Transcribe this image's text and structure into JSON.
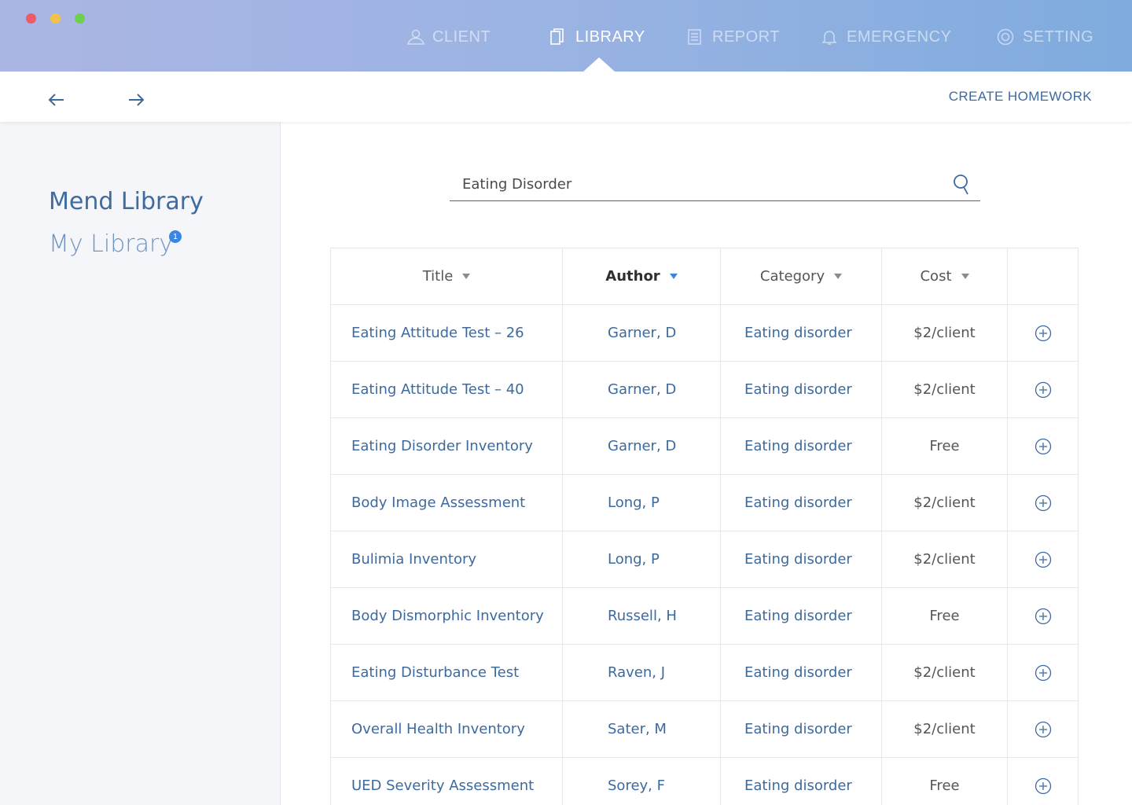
{
  "nav": {
    "items": [
      {
        "label": "CLIENT",
        "icon": "user-icon"
      },
      {
        "label": "LIBRARY",
        "icon": "library-icon"
      },
      {
        "label": "REPORT",
        "icon": "report-icon"
      },
      {
        "label": "EMERGENCY",
        "icon": "bell-icon"
      },
      {
        "label": "SETTING",
        "icon": "settings-icon"
      }
    ],
    "active": "LIBRARY"
  },
  "toolbar": {
    "create_label": "CREATE HOMEWORK"
  },
  "sidebar": {
    "mend_library": "Mend Library",
    "my_library": "My Library",
    "my_library_badge": "1"
  },
  "search": {
    "value": "Eating Disorder",
    "placeholder": ""
  },
  "table": {
    "headers": {
      "title": "Title",
      "author": "Author",
      "category": "Category",
      "cost": "Cost"
    },
    "sorted_by": "Author",
    "rows": [
      {
        "title": "Eating Attitude Test – 26",
        "author": "Garner, D",
        "category": "Eating disorder",
        "cost": "$2/client"
      },
      {
        "title": "Eating Attitude Test – 40",
        "author": "Garner, D",
        "category": "Eating disorder",
        "cost": "$2/client"
      },
      {
        "title": "Eating Disorder Inventory",
        "author": "Garner, D",
        "category": "Eating disorder",
        "cost": "Free"
      },
      {
        "title": "Body Image Assessment",
        "author": "Long, P",
        "category": "Eating disorder",
        "cost": "$2/client"
      },
      {
        "title": "Bulimia Inventory",
        "author": "Long, P",
        "category": "Eating disorder",
        "cost": "$2/client"
      },
      {
        "title": "Body Dismorphic Inventory",
        "author": "Russell, H",
        "category": "Eating disorder",
        "cost": "Free"
      },
      {
        "title": "Eating Disturbance Test",
        "author": "Raven, J",
        "category": "Eating disorder",
        "cost": "$2/client"
      },
      {
        "title": "Overall Health Inventory",
        "author": "Sater, M",
        "category": "Eating disorder",
        "cost": "$2/client"
      },
      {
        "title": "UED Severity Assessment",
        "author": "Sorey, F",
        "category": "Eating disorder",
        "cost": "Free"
      }
    ]
  },
  "colors": {
    "accent": "#3d6a9e",
    "badge": "#3c86e0",
    "sidebar_bg": "#f4f6fa",
    "gradient_start": "#abb5e3",
    "gradient_end": "#7fabde"
  }
}
